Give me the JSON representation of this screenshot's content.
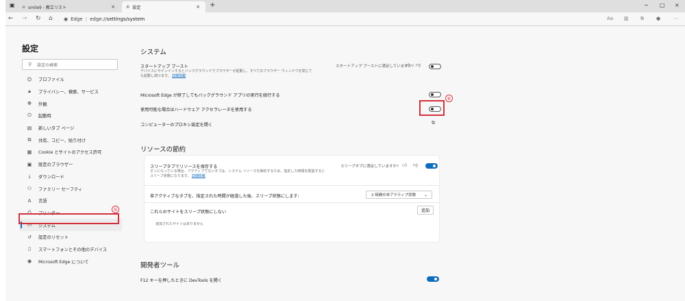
{
  "browser": {
    "tabs": [
      {
        "label": "smile9 - 教立リスト",
        "close": "×"
      },
      {
        "label": "設定",
        "close": "×"
      }
    ],
    "new_tab": "+",
    "window_controls": {
      "minimize": "−",
      "maximize": "□",
      "close": "×"
    },
    "url_site": "Edge",
    "url_prefix": "edge://",
    "url_path": "settings/system"
  },
  "sidebar": {
    "title": "設定",
    "search_placeholder": "設定の検索",
    "items": [
      {
        "label": "プロファイル",
        "icon": "person-icon"
      },
      {
        "label": "プライバシー、検索、サービス",
        "icon": "lock-icon"
      },
      {
        "label": "外観",
        "icon": "palette-icon"
      },
      {
        "label": "起動時",
        "icon": "power-icon"
      },
      {
        "label": "新しいタブ ページ",
        "icon": "new-tab-icon"
      },
      {
        "label": "共有、コピー、貼り付け",
        "icon": "share-icon"
      },
      {
        "label": "Cookie とサイトのアクセス許可",
        "icon": "cookie-icon"
      },
      {
        "label": "既定のブラウザー",
        "icon": "browser-icon"
      },
      {
        "label": "ダウンロード",
        "icon": "download-icon"
      },
      {
        "label": "ファミリー セーフティ",
        "icon": "family-icon"
      },
      {
        "label": "言語",
        "icon": "language-icon"
      },
      {
        "label": "プリンター",
        "icon": "printer-icon"
      },
      {
        "label": "システム",
        "icon": "system-icon"
      },
      {
        "label": "設定のリセット",
        "icon": "reset-icon"
      },
      {
        "label": "スマートフォンとその他のデバイス",
        "icon": "phone-icon"
      },
      {
        "label": "Microsoft Edge について",
        "icon": "edge-icon"
      }
    ],
    "callout": "⑤"
  },
  "system": {
    "title": "システム",
    "startup_boost": {
      "label": "スタートアップ ブースト",
      "desc": "デバイスにサインインするとバックグラウンドでブラウザーが起動し、すべてのブラウザー ウィンドウを閉じても起動し続けます。",
      "link": "詳細情報",
      "feedback": "スタートアップ ブーストに満足していますか?",
      "enabled": false
    },
    "background_apps": {
      "label": "Microsoft Edge が終了してもバックグラウンド アプリの実行を続行する",
      "enabled": false
    },
    "hardware_accel": {
      "label": "使用可能な場合はハードウェア アクセラレータを使用する",
      "enabled": false,
      "callout": "⑥"
    },
    "proxy": {
      "label": "コンピューターのプロキシ設定を開く"
    }
  },
  "resources": {
    "title": "リソースの節約",
    "sleeping_tabs": {
      "label": "スリープタブでリソースを保存する",
      "desc": "オンになっている場合、アクティブでないタブは、システム リソースを節約するため、指定した時間を経過するとスリープ状態になります。",
      "link": "詳細情報",
      "feedback": "スリープタブに満足していますか?",
      "enabled": true
    },
    "inactive_time": {
      "label": "非アクティブなタブを、指定された時間が経過した後、スリープ状態にします:",
      "value": "2 時間の非アクティブ状態"
    },
    "never_sleep": {
      "label": "これらのサイトをスリープ状態にしない",
      "add_button": "追加",
      "empty": "追加されたサイトはありません"
    }
  },
  "developer": {
    "title": "開発者ツール",
    "devtools_f12": {
      "label": "F12 キーを押したときに DevTools を開く",
      "enabled": true
    }
  },
  "colors": {
    "accent": "#0f6cbd",
    "highlight": "#d32f3b"
  }
}
